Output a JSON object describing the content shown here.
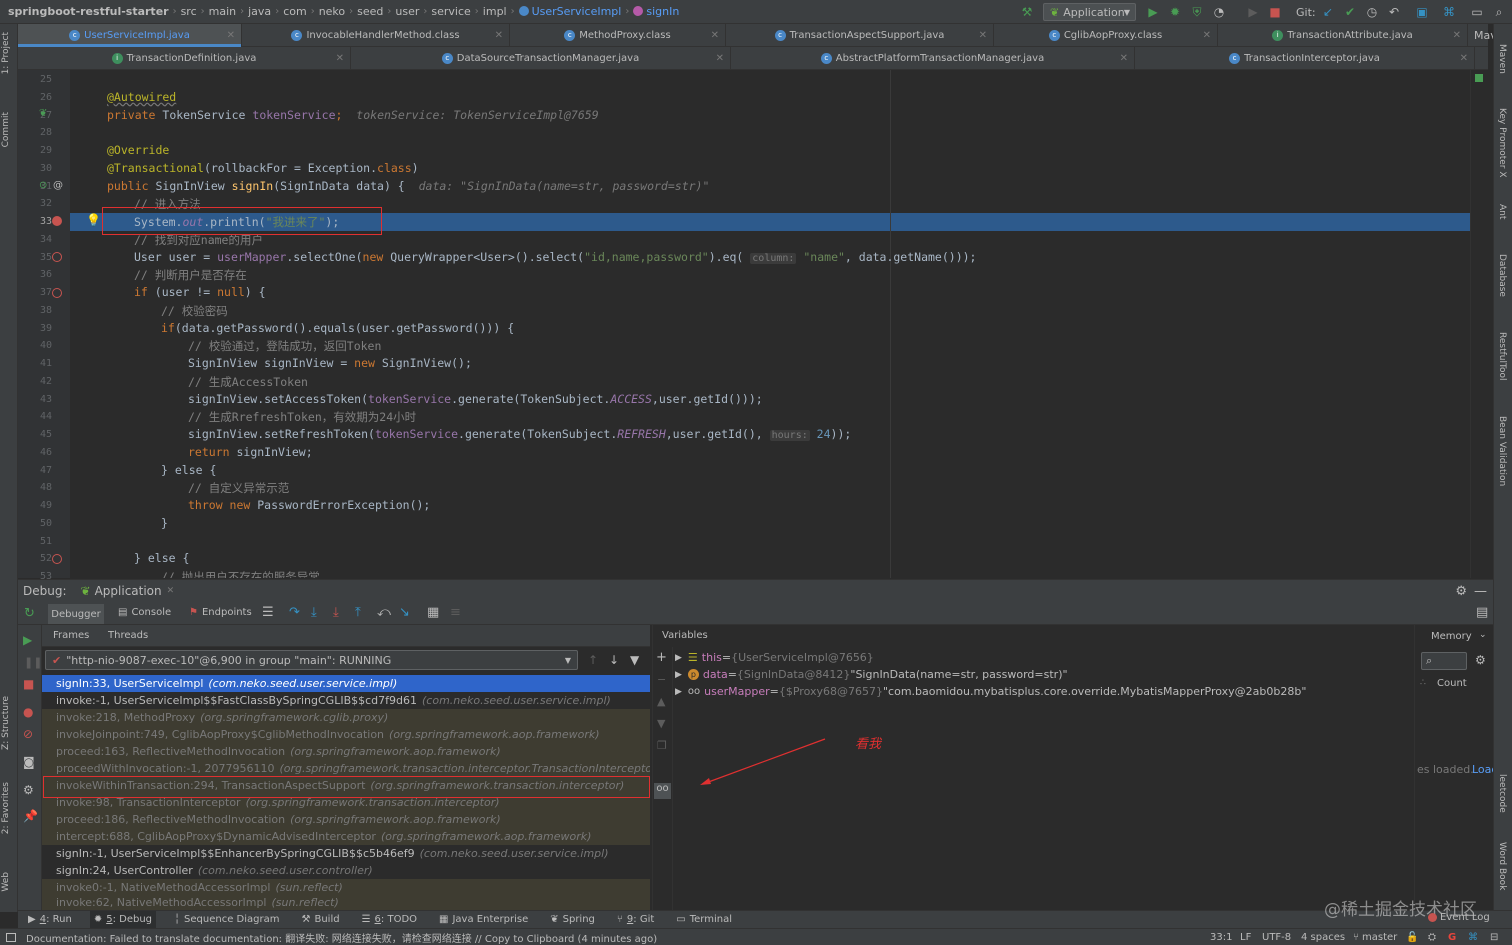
{
  "breadcrumbs": [
    "springboot-restful-starter",
    "src",
    "main",
    "java",
    "com",
    "neko",
    "seed",
    "user",
    "service",
    "impl",
    "UserServiceImpl",
    "signIn"
  ],
  "toolbar": {
    "run_config": "Application",
    "git_label": "Git:"
  },
  "tabs_row1": [
    {
      "label": "UserServiceImpl.java",
      "active": true
    },
    {
      "label": "InvocableHandlerMethod.class"
    },
    {
      "label": "MethodProxy.class"
    },
    {
      "label": "TransactionAspectSupport.java"
    },
    {
      "label": "CglibAopProxy.class"
    },
    {
      "label": "TransactionAttribute.java"
    }
  ],
  "tabs_row2": [
    {
      "label": "TransactionDefinition.java"
    },
    {
      "label": "DataSourceTransactionManager.java"
    },
    {
      "label": "AbstractPlatformTransactionManager.java"
    },
    {
      "label": "TransactionInterceptor.java"
    }
  ],
  "right_tab_cut": "Mav",
  "line_numbers": [
    "25",
    "26",
    "27",
    "28",
    "29",
    "30",
    "31",
    "32",
    "33",
    "34",
    "35",
    "36",
    "37",
    "38",
    "39",
    "40",
    "41",
    "42",
    "43",
    "44",
    "45",
    "46",
    "47",
    "48",
    "49",
    "50",
    "51",
    "52",
    "53"
  ],
  "code": {
    "l26": "@Autowired",
    "l27a": "private ",
    "l27b": "TokenService ",
    "l27c": "tokenService",
    "l27d": ";",
    "l27hint": "tokenService: TokenServiceImpl@7659",
    "l29": "@Override",
    "l30a": "@Transactional",
    "l30b": "(rollbackFor = Exception.",
    "l30c": "class",
    "l30d": ")",
    "l31a": "public ",
    "l31b": "SignInView ",
    "l31c": "signIn",
    "l31d": "(SignInData data) {",
    "l31hint": "data: \"SignInData(name=str, password=str)\"",
    "l32": "// 进入方法",
    "l33a": "System.",
    "l33b": "out",
    "l33c": ".println(",
    "l33d": "\"我进来了\"",
    "l33e": ");",
    "l34": "// 找到对应name的用户",
    "l35a": "User user = ",
    "l35b": "userMapper",
    "l35c": ".selectOne(",
    "l35d": "new ",
    "l35e": "QueryWrapper<User>().select(",
    "l35f": "\"id,name,password\"",
    "l35g": ").eq(",
    "l35ph": "column:",
    "l35h": "\"name\"",
    "l35i": ", data.getName()));",
    "l36": "// 判断用户是否存在",
    "l37a": "if ",
    "l37b": "(user != ",
    "l37c": "null",
    "l37d": ") {",
    "l38": "// 校验密码",
    "l39a": "if",
    "l39b": "(data.getPassword().equals(user.getPassword())) {",
    "l40": "// 校验通过，登陆成功，返回Token",
    "l41a": "SignInView signInView = ",
    "l41b": "new ",
    "l41c": "SignInView();",
    "l42": "// 生成AccessToken",
    "l43a": "signInView.setAccessToken(",
    "l43b": "tokenService",
    "l43c": ".generate(TokenSubject.",
    "l43d": "ACCESS",
    "l43e": ",user.getId()));",
    "l44": "// 生成RrefreshToken，有效期为24小时",
    "l45a": "signInView.setRefreshToken(",
    "l45b": "tokenService",
    "l45c": ".generate(TokenSubject.",
    "l45d": "REFRESH",
    "l45e": ",user.getId(), ",
    "l45ph": "hours:",
    "l45f": "24",
    "l45g": "));",
    "l46a": "return ",
    "l46b": "signInView;",
    "l47": "} else {",
    "l48": "// 自定义异常示范",
    "l49a": "throw ",
    "l49b": "new ",
    "l49c": "PasswordErrorException();",
    "l50": "}",
    "l52": "} else {",
    "l53": "// 抛出用户不存在的服务异常"
  },
  "debug": {
    "title": "Debug:",
    "session": "Application",
    "tabs": [
      "Debugger",
      "Console",
      "Endpoints"
    ],
    "frames_label": "Frames",
    "threads_label": "Threads",
    "thread": "\"http-nio-9087-exec-10\"@6,900 in group \"main\": RUNNING",
    "frames": [
      {
        "m": "signIn:33, UserServiceImpl",
        "p": "(com.neko.seed.user.service.impl)",
        "kind": "sel"
      },
      {
        "m": "invoke:-1, UserServiceImpl$$FastClassBySpringCGLIB$$cd7f9d61",
        "p": "(com.neko.seed.user.service.impl)",
        "kind": "usr"
      },
      {
        "m": "invoke:218, MethodProxy",
        "p": "(org.springframework.cglib.proxy)",
        "kind": "lib"
      },
      {
        "m": "invokeJoinpoint:749, CglibAopProxy$CglibMethodInvocation",
        "p": "(org.springframework.aop.framework)",
        "kind": "lib"
      },
      {
        "m": "proceed:163, ReflectiveMethodInvocation",
        "p": "(org.springframework.aop.framework)",
        "kind": "lib"
      },
      {
        "m": "proceedWithInvocation:-1, 2077956110",
        "p": "(org.springframework.transaction.interceptor.TransactionInterceptor$",
        "kind": "lib"
      },
      {
        "m": "invokeWithinTransaction:294, TransactionAspectSupport",
        "p": "(org.springframework.transaction.interceptor)",
        "kind": "lib"
      },
      {
        "m": "invoke:98, TransactionInterceptor",
        "p": "(org.springframework.transaction.interceptor)",
        "kind": "lib"
      },
      {
        "m": "proceed:186, ReflectiveMethodInvocation",
        "p": "(org.springframework.aop.framework)",
        "kind": "lib"
      },
      {
        "m": "intercept:688, CglibAopProxy$DynamicAdvisedInterceptor",
        "p": "(org.springframework.aop.framework)",
        "kind": "lib"
      },
      {
        "m": "signIn:-1, UserServiceImpl$$EnhancerBySpringCGLIB$$c5b46ef9",
        "p": "(com.neko.seed.user.service.impl)",
        "kind": "usr"
      },
      {
        "m": "signIn:24, UserController",
        "p": "(com.neko.seed.user.controller)",
        "kind": "usr"
      },
      {
        "m": "invoke0:-1, NativeMethodAccessorImpl",
        "p": "(sun.reflect)",
        "kind": "lib"
      },
      {
        "m": "invoke:62, NativeMethodAccessorImpl",
        "p": "(sun.reflect)",
        "kind": "lib"
      }
    ],
    "variables_label": "Variables",
    "vars": [
      {
        "name": "this",
        "eq": " = ",
        "type": "{UserServiceImpl@7656}",
        "val": ""
      },
      {
        "name": "data",
        "eq": " = ",
        "type": "{SignInData@8412}",
        "val": " \"SignInData(name=str, password=str)\""
      },
      {
        "name": "userMapper",
        "eq": " = ",
        "type": "{$Proxy68@7657}",
        "val": " \"com.baomidou.mybatisplus.core.override.MybatisMapperProxy@2ab0b28b\""
      }
    ],
    "loaded_text": "es loaded.",
    "load_link": "Load",
    "memory_label": "Memory",
    "count_label": "Count",
    "annotation": "看我"
  },
  "toolwindows": [
    {
      "num": "4",
      "label": ": Run"
    },
    {
      "num": "5",
      "label": ": Debug",
      "active": true
    },
    {
      "num": "",
      "label": "Sequence Diagram"
    },
    {
      "num": "",
      "label": "Build"
    },
    {
      "num": "6",
      "label": ": TODO"
    },
    {
      "num": "",
      "label": "Java Enterprise"
    },
    {
      "num": "",
      "label": "Spring"
    },
    {
      "num": "9",
      "label": ": Git"
    },
    {
      "num": "",
      "label": "Terminal"
    }
  ],
  "event_log": "Event Log",
  "watermark": "@稀土掘金技术社区",
  "status": {
    "message": "Documentation: Failed to translate documentation: 翻译失败: 网络连接失败，请检查网络连接 // Copy to Clipboard (4 minutes ago)",
    "pos": "33:1",
    "eol": "LF",
    "enc": "UTF-8",
    "indent": "4 spaces",
    "branch": "master"
  },
  "left_strip": [
    "1: Project",
    "Commit",
    "Z: Structure",
    "2: Favorites",
    "Web"
  ],
  "right_strip": [
    "Maven",
    "Key Promoter X",
    "Ant",
    "Database",
    "RestfulTool",
    "Bean Validation",
    "leetcode",
    "Word Book"
  ],
  "colors": {
    "accent": "#4a88c7",
    "selection": "#2f65ca",
    "current_line": "#2d5a8c",
    "annotation_red": "#e03030"
  }
}
